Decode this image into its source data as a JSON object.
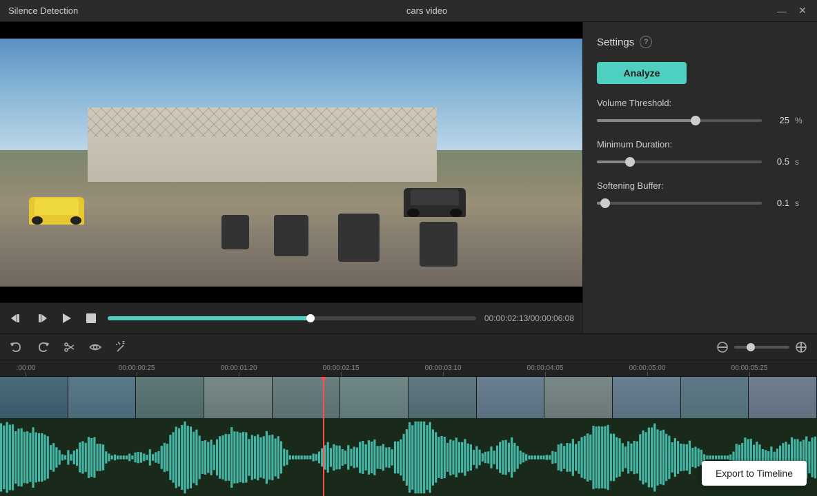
{
  "titlebar": {
    "app_title": "Silence Detection",
    "file_name": "cars video",
    "minimize_label": "—",
    "close_label": "✕"
  },
  "settings": {
    "title": "Settings",
    "info_icon": "?",
    "analyze_label": "Analyze",
    "volume_threshold": {
      "label": "Volume Threshold:",
      "value": "25",
      "unit": "%",
      "fill_percent": 60
    },
    "minimum_duration": {
      "label": "Minimum Duration:",
      "value": "0.5",
      "unit": "s",
      "fill_percent": 20
    },
    "softening_buffer": {
      "label": "Softening Buffer:",
      "value": "0.1",
      "unit": "s",
      "fill_percent": 5
    }
  },
  "video_controls": {
    "prev_frame": "⏮",
    "next_frame_step": "⏭",
    "play": "▶",
    "stop": "■",
    "current_time": "00:00:02:13",
    "total_time": "00:00:06:08",
    "time_separator": "/"
  },
  "timeline": {
    "undo_icon": "undo",
    "redo_icon": "redo",
    "scissors_icon": "scissors",
    "eye_icon": "eye",
    "magic_icon": "wand",
    "zoom_out_icon": "minus",
    "zoom_in_icon": "plus",
    "ruler_ticks": [
      {
        "label": ":00:00",
        "position_percent": 2
      },
      {
        "label": "00:00:00:25",
        "position_percent": 14.5
      },
      {
        "label": "00:00:01:20",
        "position_percent": 27
      },
      {
        "label": "00:00:02:15",
        "position_percent": 39.5
      },
      {
        "label": "00:00:03:10",
        "position_percent": 52
      },
      {
        "label": "00:00:04:05",
        "position_percent": 64.5
      },
      {
        "label": "00:00:05:00",
        "position_percent": 77
      },
      {
        "label": "00:00:05:25",
        "position_percent": 89.5
      }
    ]
  },
  "footer": {
    "export_label": "Export to Timeline"
  },
  "colors": {
    "accent": "#4ecfc0",
    "playhead": "#ff4d4d",
    "waveform": "#4ecfc0",
    "export_bg": "#ffffff"
  }
}
